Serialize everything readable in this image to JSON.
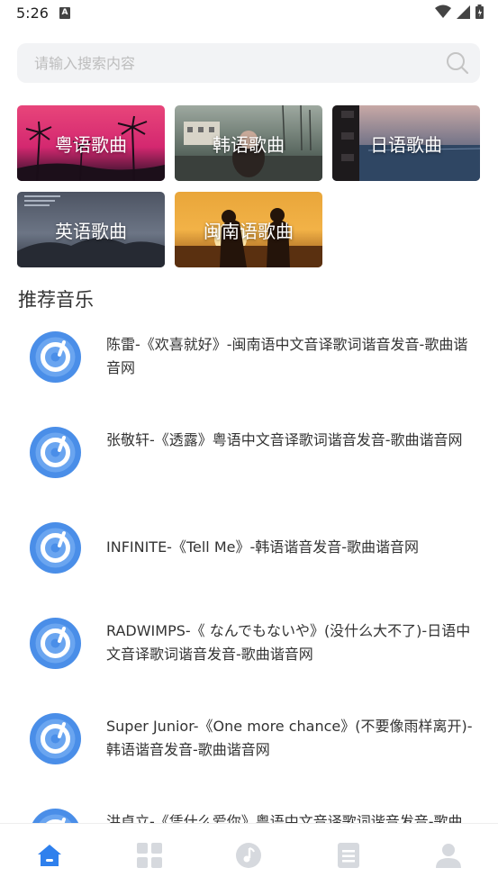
{
  "status_bar": {
    "time": "5:26",
    "notif_letter": "A"
  },
  "search": {
    "placeholder": "请输入搜索内容"
  },
  "categories": [
    {
      "label": "粤语歌曲"
    },
    {
      "label": "韩语歌曲"
    },
    {
      "label": "日语歌曲"
    },
    {
      "label": "英语歌曲"
    },
    {
      "label": "闽南语歌曲"
    }
  ],
  "section": {
    "title": "推荐音乐"
  },
  "songs": [
    {
      "title": "陈雷-《欢喜就好》-闽南语中文音译歌词谐音发音-歌曲谐音网"
    },
    {
      "title": "张敬轩-《透露》粤语中文音译歌词谐音发音-歌曲谐音网"
    },
    {
      "title": "INFINITE-《Tell Me》-韩语谐音发音-歌曲谐音网"
    },
    {
      "title": "RADWIMPS-《 なんでもないや》(没什么大不了)-日语中文音译歌词谐音发音-歌曲谐音网"
    },
    {
      "title": "Super Junior-《One more chance》(不要像雨样离开)-韩语谐音发音-歌曲谐音网"
    },
    {
      "title": "洪卓立-《凭什么爱你》粤语中文音译歌词谐音发音-歌曲谐音网"
    }
  ],
  "tabbar": {
    "icons": [
      "home-icon",
      "grid-icon",
      "music-icon",
      "document-icon",
      "user-icon"
    ],
    "active_index": 0
  },
  "colors": {
    "accent": "#2f80ed",
    "inactive_tab": "#d6d9de",
    "disc_outer": "#4a8ee8"
  }
}
